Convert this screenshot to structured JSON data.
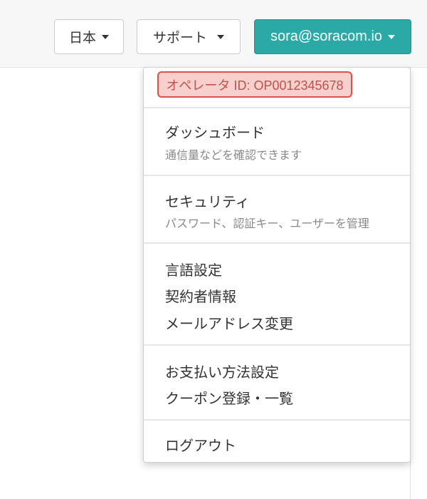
{
  "header": {
    "language_label": "日本",
    "support_label": "サポート",
    "user_label": "sora@soracom.io"
  },
  "dropdown": {
    "operator_id": "オペレータ ID: OP0012345678",
    "dashboard": {
      "label": "ダッシュボード",
      "description": "通信量などを確認できます"
    },
    "security": {
      "label": "セキュリティ",
      "description": "パスワード、認証キー、ユーザーを管理"
    },
    "language_settings": "言語設定",
    "contractor_info": "契約者情報",
    "email_change": "メールアドレス変更",
    "payment_settings": "お支払い方法設定",
    "coupon_register": "クーポン登録・一覧",
    "logout": "ログアウト"
  },
  "colors": {
    "accent": "#2aa9a6",
    "highlight_border": "#e0504a",
    "highlight_fill": "#f7cfcc"
  }
}
